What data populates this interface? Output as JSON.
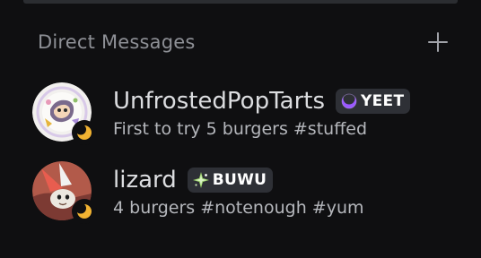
{
  "section": {
    "title": "Direct Messages"
  },
  "conversations": [
    {
      "username": "UnfrostedPopTarts",
      "badge": {
        "text": "YEET",
        "icon": "crescent-moon-icon",
        "color": "#9b59ff"
      },
      "status": {
        "type": "idle",
        "icon": "moon-icon",
        "color": "#f0b232"
      },
      "activity": "First to try 5 burgers #stuffed",
      "avatar_icon": "cartoon-avatar"
    },
    {
      "username": "lizard",
      "badge": {
        "text": "BUWU",
        "icon": "sparkle-icon",
        "color": "#9bd36a"
      },
      "status": {
        "type": "idle",
        "icon": "moon-icon",
        "color": "#f0b232"
      },
      "activity": "4 burgers #notenough #yum",
      "avatar_icon": "lizard-avatar"
    }
  ]
}
